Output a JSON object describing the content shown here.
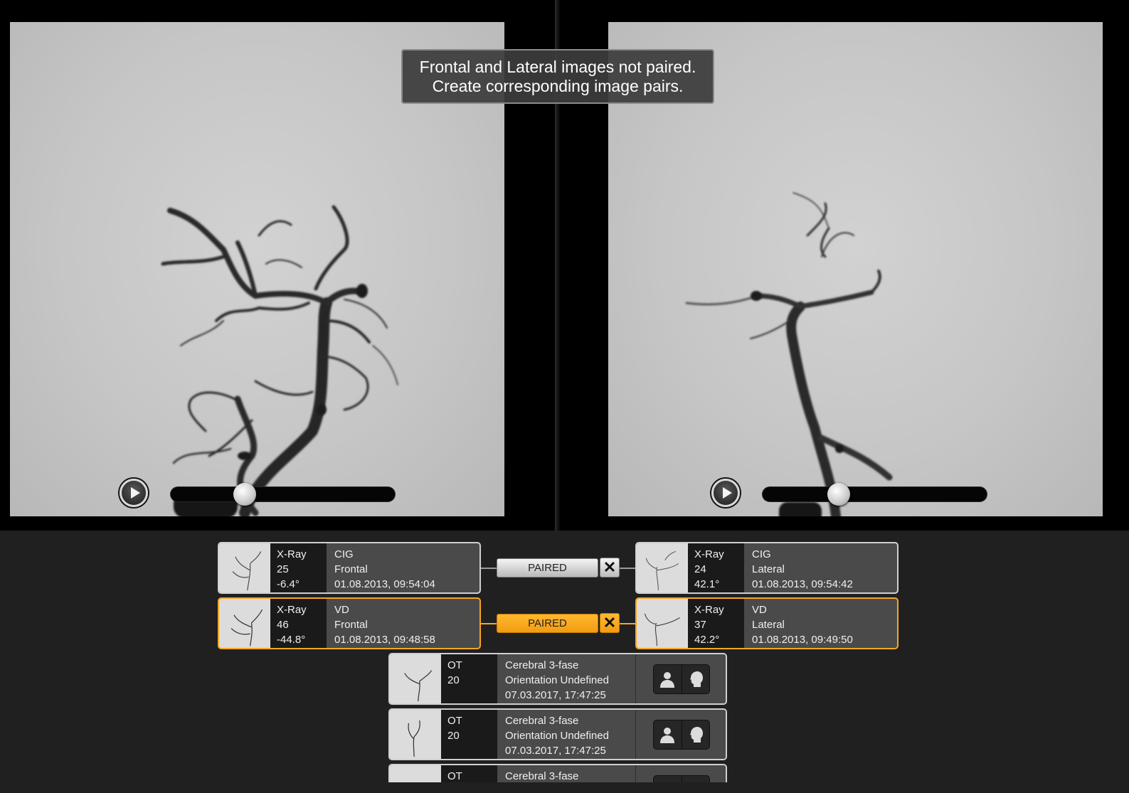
{
  "viewer": {
    "warning_line1": "Frontal and Lateral images not paired.",
    "warning_line2": "Create corresponding image pairs.",
    "left": {
      "play_icon": "play-icon",
      "frame_position": 0.31
    },
    "right": {
      "play_icon": "play-icon",
      "frame_position": 0.32
    }
  },
  "pairs": [
    {
      "status": "PAIRED",
      "selected": false,
      "frontal": {
        "modality": "X-Ray",
        "frames": "25",
        "angle": "-6.4°",
        "protocol": "CIG",
        "orientation": "Frontal",
        "datetime": "01.08.2013, 09:54:04"
      },
      "lateral": {
        "modality": "X-Ray",
        "frames": "24",
        "angle": "42.1°",
        "protocol": "CIG",
        "orientation": "Lateral",
        "datetime": "01.08.2013, 09:54:42"
      }
    },
    {
      "status": "PAIRED",
      "selected": true,
      "frontal": {
        "modality": "X-Ray",
        "frames": "46",
        "angle": "-44.8°",
        "protocol": "VD",
        "orientation": "Frontal",
        "datetime": "01.08.2013, 09:48:58"
      },
      "lateral": {
        "modality": "X-Ray",
        "frames": "37",
        "angle": "42.2°",
        "protocol": "VD",
        "orientation": "Lateral",
        "datetime": "01.08.2013, 09:49:50"
      }
    }
  ],
  "unpaired": [
    {
      "modality": "OT",
      "frames": "20",
      "protocol": "Cerebral 3-fase",
      "orientation": "Orientation Undefined",
      "datetime": "07.03.2017, 17:47:25"
    },
    {
      "modality": "OT",
      "frames": "20",
      "protocol": "Cerebral 3-fase",
      "orientation": "Orientation Undefined",
      "datetime": "07.03.2017, 17:47:25"
    },
    {
      "modality": "OT",
      "frames": "",
      "protocol": "Cerebral 3-fase",
      "orientation": "",
      "datetime": ""
    }
  ],
  "icons": {
    "frontal_orientation": "person-frontal-icon",
    "lateral_orientation": "head-lateral-icon",
    "unpair": "close-icon"
  },
  "colors": {
    "selected_border": "#f5a623",
    "paired_active": "#f7a21b"
  }
}
